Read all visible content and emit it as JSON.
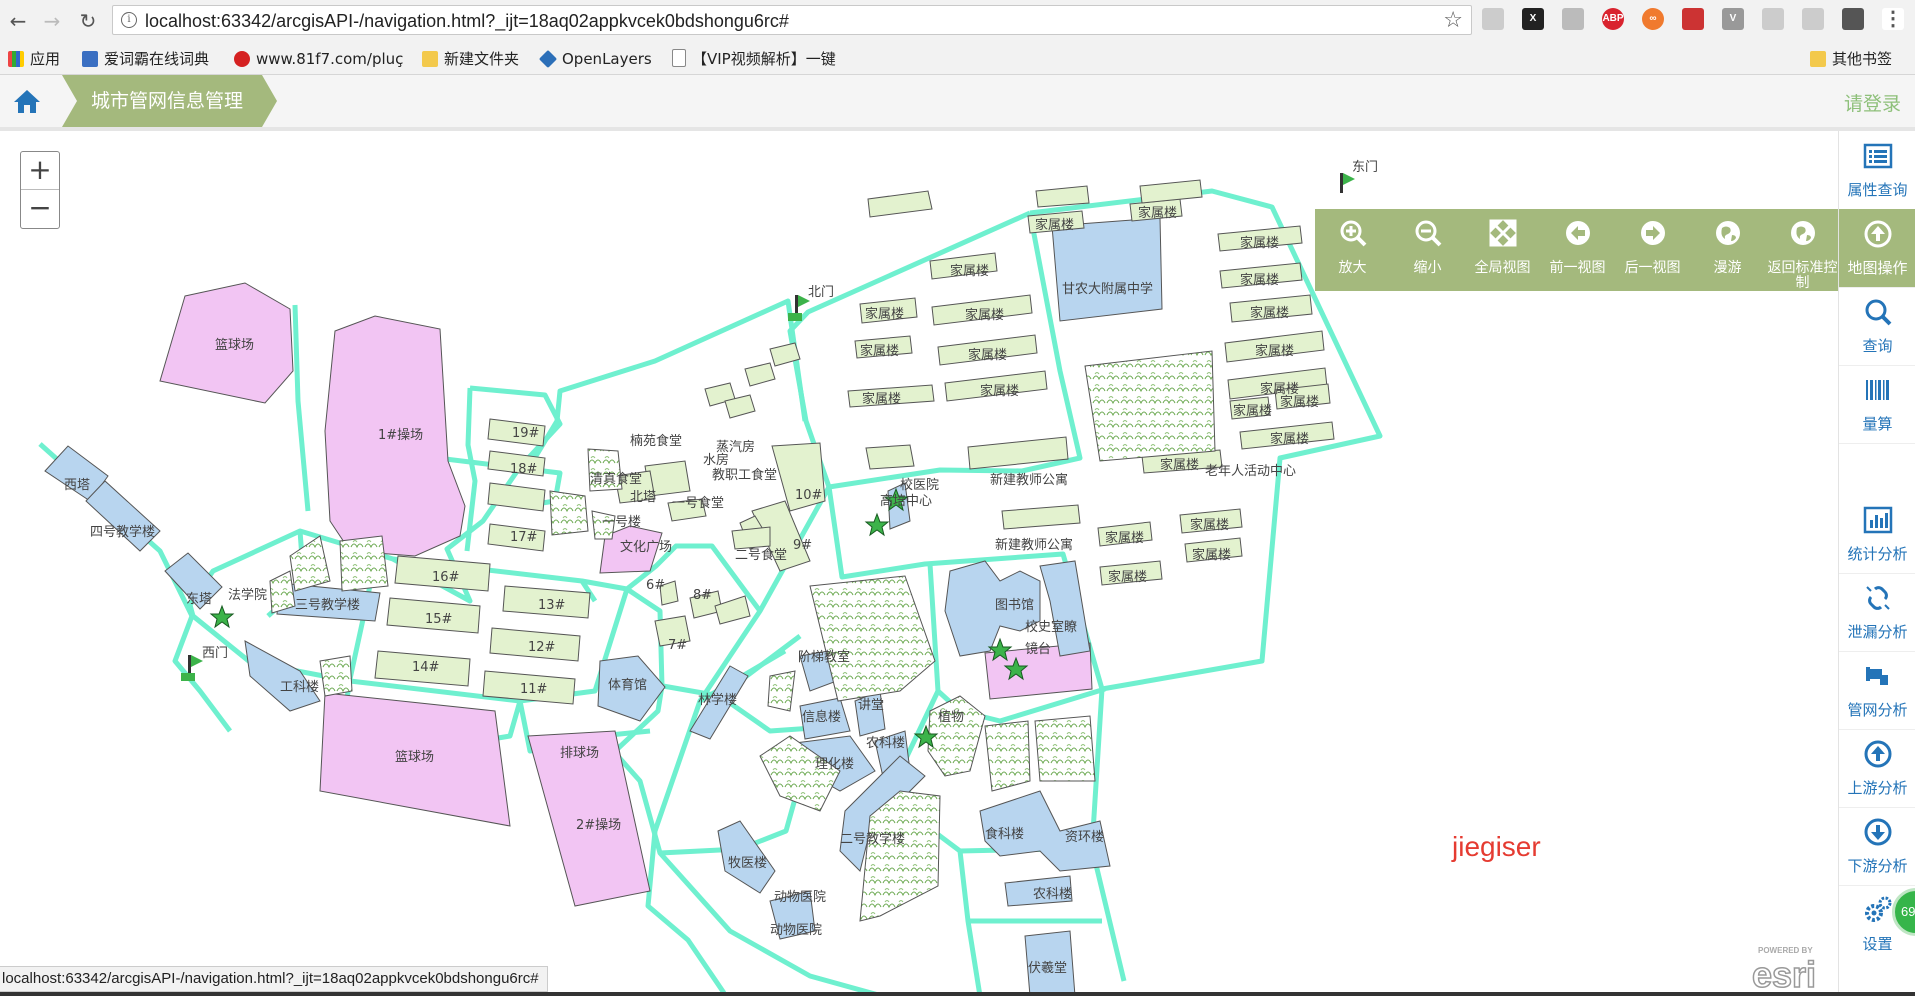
{
  "browser": {
    "url": "localhost:63342/arcgisAPI-/navigation.html?_ijt=18aq02appkvcek0bdshongu6rc#",
    "bookmarks": [
      "应用",
      "爱词霸在线词典",
      "www.81f7.com/pluç",
      "新建文件夹",
      "OpenLayers",
      "【VIP视频解析】一键"
    ],
    "other_bookmarks": "其他书签",
    "extensions": [
      "ABP"
    ],
    "status_url": "localhost:63342/arcgisAPI-/navigation.html?_ijt=18aq02appkvcek0bdshongu6rc#"
  },
  "app": {
    "breadcrumb": "城市管网信息管理",
    "login": "请登录",
    "accent": "#a4b97d",
    "link_color": "#2474b8"
  },
  "zoom": {
    "plus": "+",
    "minus": "−"
  },
  "toolbar": [
    {
      "label": "放大",
      "icon": "zoom-in-icon"
    },
    {
      "label": "缩小",
      "icon": "zoom-out-icon"
    },
    {
      "label": "全局视图",
      "icon": "full-extent-icon"
    },
    {
      "label": "前一视图",
      "icon": "arrow-left-icon"
    },
    {
      "label": "后一视图",
      "icon": "arrow-right-icon"
    },
    {
      "label": "漫游",
      "icon": "globe-icon"
    },
    {
      "label": "返回标准控制",
      "icon": "globe-return-icon"
    }
  ],
  "sidebar": [
    {
      "label": "属性查询",
      "icon": "list-icon"
    },
    {
      "label": "地图操作",
      "icon": "arrow-up-circle-icon"
    },
    {
      "label": "查询",
      "icon": "search-icon"
    },
    {
      "label": "量算",
      "icon": "barcode-icon"
    },
    {
      "label": "统计分析",
      "icon": "bar-chart-icon"
    },
    {
      "label": "泄漏分析",
      "icon": "broken-link-icon"
    },
    {
      "label": "管网分析",
      "icon": "pipe-icon"
    },
    {
      "label": "上游分析",
      "icon": "arrow-up-circle-icon"
    },
    {
      "label": "下游分析",
      "icon": "arrow-down-circle-icon"
    },
    {
      "label": "设置",
      "icon": "gears-icon"
    }
  ],
  "badge": "69",
  "watermark": "jiegiser",
  "esri": {
    "powered": "POWERED BY",
    "brand": "esri"
  },
  "map_labels": {
    "gates": [
      "东门",
      "北门",
      "西门"
    ],
    "family_houses": "家属楼",
    "places": [
      "篮球场",
      "1#操场",
      "西塔",
      "四号教学楼",
      "东塔",
      "体育馆",
      "三号教学楼",
      "工科楼",
      "篮球场",
      "排球场",
      "2#操场",
      "甘农大附属中学",
      "老年人活动中心",
      "新建教师公寓",
      "校医院",
      "图书馆",
      "校史室瞭",
      "镜台",
      "文化广场",
      "一号食堂",
      "二号食堂",
      "教职工食堂",
      "清真食堂",
      "楠苑食堂",
      "水房",
      "北塔",
      "19#",
      "18#",
      "17#",
      "16#",
      "15#",
      "14#",
      "13#",
      "12#",
      "11#",
      "10#",
      "9#",
      "8#",
      "7#",
      "6#",
      "林学楼",
      "阶梯教室",
      "信息楼",
      "讲堂",
      "理化楼",
      "农科楼",
      "二号教学楼",
      "动物医院",
      "动物医院",
      "牧医楼",
      "食科楼",
      "资环楼",
      "农科楼",
      "伏羲堂",
      "植物",
      "法学院",
      "高培中心",
      "新建教师公寓",
      "蒸汽房",
      "一号楼"
    ]
  }
}
